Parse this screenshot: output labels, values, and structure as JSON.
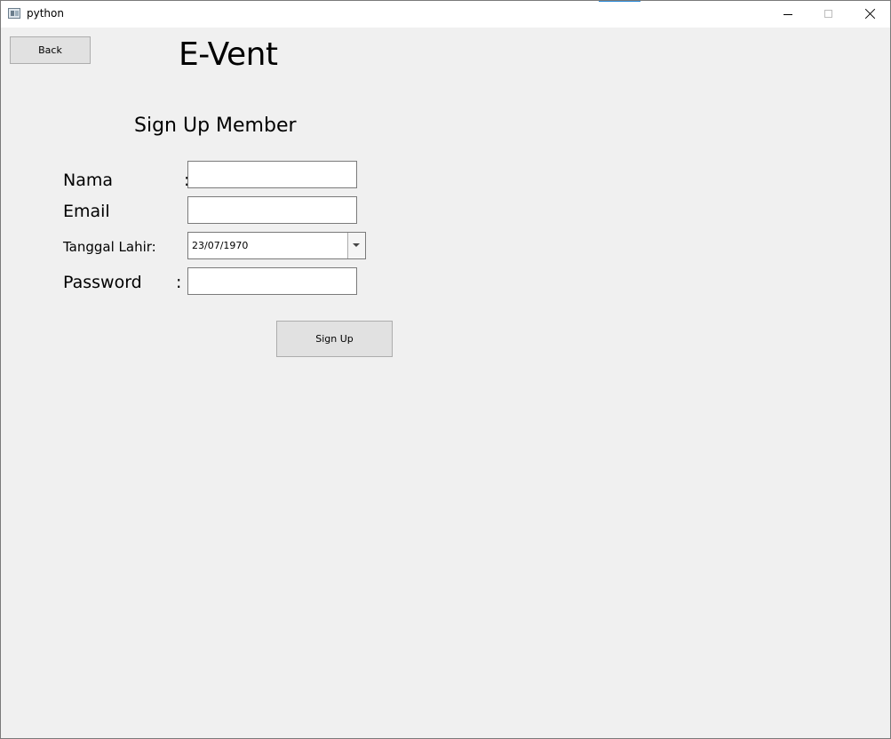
{
  "window": {
    "title": "python",
    "icon": "app-window-icon",
    "controls": {
      "minimize_icon": "minimize-icon",
      "maximize_icon": "maximize-icon",
      "close_icon": "close-icon"
    }
  },
  "header": {
    "back_label": "Back",
    "app_title": "E-Vent"
  },
  "form": {
    "heading": "Sign Up Member",
    "nama_label": "Nama",
    "nama_colon": ":",
    "nama_value": "",
    "email_label": "Email",
    "email_value": "",
    "tanggal_label": "Tanggal Lahir:",
    "tanggal_value": "23/07/1970",
    "password_label": "Password",
    "password_colon": ":",
    "password_value": "",
    "submit_label": "Sign Up"
  },
  "colors": {
    "window_bg": "#f0f0f0",
    "titlebar_bg": "#ffffff",
    "button_bg": "#e1e1e1",
    "button_border": "#adadad",
    "accent": "#2e8bd8"
  }
}
